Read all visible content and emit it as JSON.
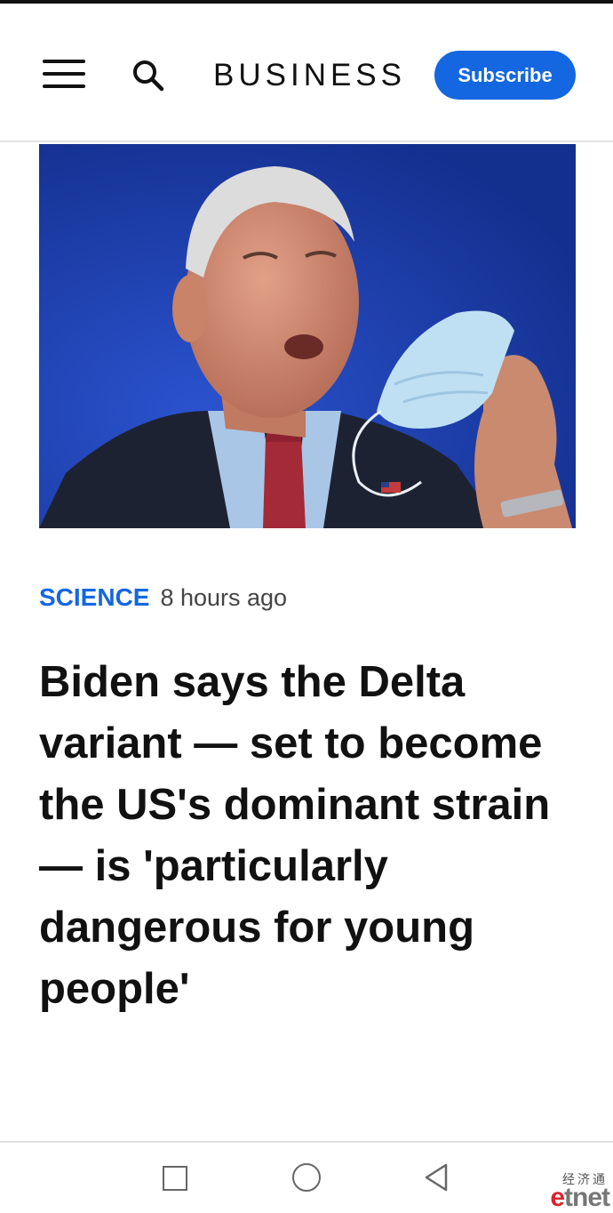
{
  "header": {
    "brand": "BUSINESS",
    "subscribe_label": "Subscribe",
    "icons": {
      "menu": "hamburger-menu-icon",
      "search": "search-icon"
    },
    "accent_color": "#1467e0"
  },
  "article": {
    "category": "SCIENCE",
    "time_ago": "8 hours ago",
    "headline": "Biden says the Delta variant — set to become the US's dominant strain — is 'particularly dangerous for young people'"
  },
  "android_nav": {
    "icons": [
      "recent-apps-icon",
      "home-icon",
      "back-icon"
    ]
  },
  "watermark": {
    "chinese": "经济通",
    "logo_e": "e",
    "logo_rest": "tnet"
  }
}
